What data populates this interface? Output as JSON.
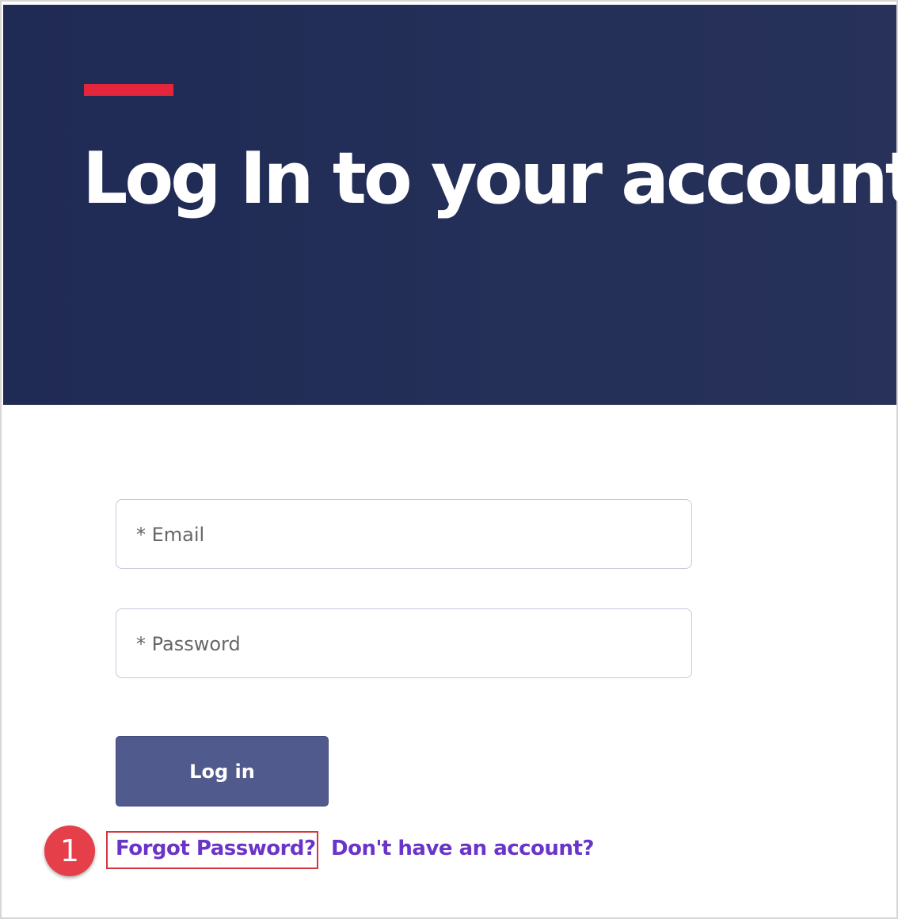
{
  "hero": {
    "title": "Log In to your account",
    "accent_color": "#e3263c",
    "background_color": "#222c58"
  },
  "form": {
    "email_label": "* Email",
    "password_label": "* Password",
    "login_label": "Log in"
  },
  "links": {
    "forgot_password": "Forgot Password?",
    "signup": "Don't have an account?"
  },
  "annotation": {
    "step_number": "1",
    "color": "#e5404a"
  }
}
